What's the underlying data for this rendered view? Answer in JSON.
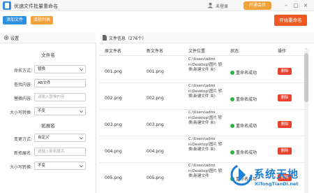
{
  "titlebar": {
    "title": "优速文件批量重命名",
    "user_status": "未登录",
    "vip_label": "开通会员",
    "minimize": "–",
    "maximize": "□",
    "close": "×"
  },
  "toolbar": {
    "add_label": "添加文件",
    "clear_label": "清除列表",
    "start_label": "开始重命名"
  },
  "settings": {
    "header": "设置",
    "filename_section": "文件名",
    "rename_mode_label": "命名方式:",
    "rename_mode_value": "替换",
    "find_label": "查找内容:",
    "find_value": "AB文件",
    "replace_label": "替换内容:",
    "replace_placeholder": "请输入替换内容",
    "case_label": "大小写转换:",
    "case_value": "不变",
    "ext_section": "拓展名",
    "ext_mode_label": "变更方式:",
    "ext_mode_value": "自定义",
    "new_ext_label": "新拓展名:",
    "new_ext_placeholder": "请输入新拓展名",
    "ext_case_label": "大小写转换:",
    "ext_case_value": "不变"
  },
  "filelist": {
    "header": "文件信息（276个）",
    "columns": [
      "原文件名",
      "新文件名",
      "文件位置",
      "状态",
      "操作"
    ],
    "rows": [
      {
        "orig": "001.png",
        "new": "001.png",
        "loc": "C:\\Users\\admi n\\Desktop\\图片 转换\\新建文件 夹)",
        "status": "重命名成功",
        "action": "删除"
      },
      {
        "orig": "002.png",
        "new": "002.png",
        "loc": "C:\\Users\\admi n\\Desktop\\图片 转换\\新建文件 夹)",
        "status": "重命名成功",
        "action": "删除"
      },
      {
        "orig": "003.png",
        "new": "003.png",
        "loc": "C:\\Users\\admi n\\Desktop\\图片 转换\\新建文件 夹)",
        "status": "重命名成功",
        "action": "删除"
      },
      {
        "orig": "004.png",
        "new": "004.png",
        "loc": "C:\\Users\\admi n\\Desktop\\图片 转换\\新建文件 夹)",
        "status": "重命名成功",
        "action": "删除"
      },
      {
        "orig": "005.png",
        "new": "005.png",
        "loc": "C:\\Users\\admi n\\Desktop\\图片 转换\\新建文件",
        "status": "重命名成功",
        "action": "删除"
      }
    ]
  },
  "watermark": {
    "title": "系统天地",
    "url": "XiTongTianDi.net"
  },
  "colors": {
    "primary_blue": "#2d8fe0",
    "orange": "#f3a23a",
    "start_red": "#ef5a22",
    "delete_red": "#e8412c",
    "success_green": "#2fb344"
  }
}
